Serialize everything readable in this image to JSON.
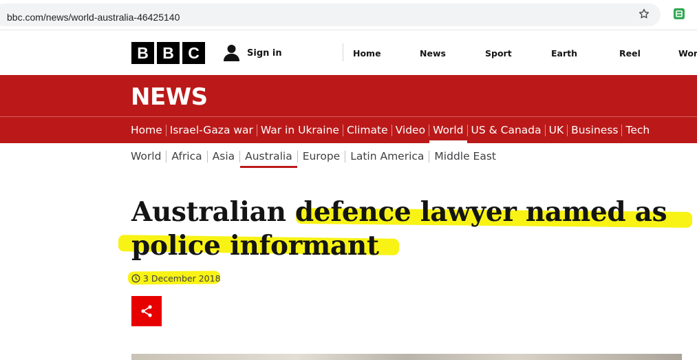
{
  "browser": {
    "url": "bbc.com/news/world-australia-46425140",
    "icons": [
      "tune-icon",
      "star-icon",
      "extension-icon"
    ]
  },
  "header": {
    "logo_letters": [
      "B",
      "B",
      "C"
    ],
    "sign_in_label": "Sign in",
    "nav": [
      {
        "label": "Home"
      },
      {
        "label": "News"
      },
      {
        "label": "Sport"
      },
      {
        "label": "Earth"
      },
      {
        "label": "Reel"
      },
      {
        "label": "Worl"
      }
    ]
  },
  "news": {
    "title": "NEWS",
    "sections": [
      {
        "label": "Home"
      },
      {
        "label": "Israel-Gaza war"
      },
      {
        "label": "War in Ukraine"
      },
      {
        "label": "Climate"
      },
      {
        "label": "Video"
      },
      {
        "label": "World",
        "active": true
      },
      {
        "label": "US & Canada"
      },
      {
        "label": "UK"
      },
      {
        "label": "Business"
      },
      {
        "label": "Tech"
      }
    ],
    "subsections": [
      {
        "label": "World"
      },
      {
        "label": "Africa"
      },
      {
        "label": "Asia"
      },
      {
        "label": "Australia",
        "active": true
      },
      {
        "label": "Europe"
      },
      {
        "label": "Latin America"
      },
      {
        "label": "Middle East"
      }
    ]
  },
  "article": {
    "headline_line1": "Australian defence lawyer named as",
    "headline_line2": "police informant",
    "date": "3 December 2018",
    "share_label": "share-icon"
  },
  "colors": {
    "bbc_red": "#bb1919",
    "share_red": "#e70000",
    "highlight": "#f7f200"
  }
}
